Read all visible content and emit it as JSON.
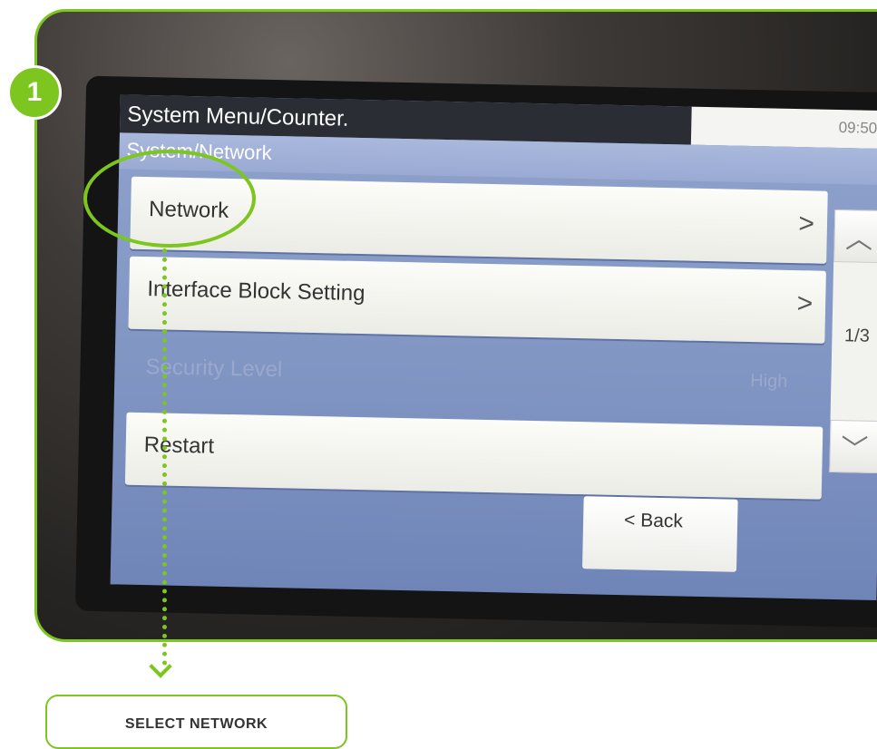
{
  "step_badge": "1",
  "screen": {
    "title": "System Menu/Counter.",
    "clock": "09:50",
    "subtitle": "System/Network",
    "items": [
      {
        "label": "Network",
        "chevron": ">"
      },
      {
        "label": "Interface Block Setting",
        "chevron": ">"
      },
      {
        "label": "Security Level",
        "value": "High"
      },
      {
        "label": "Restart"
      }
    ],
    "scroll": {
      "up": "︿",
      "down": "﹀",
      "page": "1/3"
    },
    "back_label": "< Back"
  },
  "caption": "SELECT NETWORK",
  "colors": {
    "accent": "#7dc51f",
    "titlebar": "#2a2d33",
    "screen_bg": "#8fa3cc"
  }
}
